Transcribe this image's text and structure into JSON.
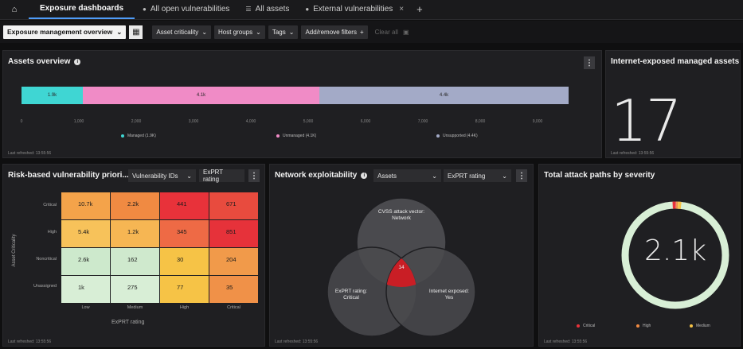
{
  "tabs": [
    {
      "label": "Exposure dashboards"
    },
    {
      "label": "All open vulnerabilities"
    },
    {
      "label": "All assets"
    },
    {
      "label": "External vulnerabilities"
    }
  ],
  "filters": {
    "view": "Exposure management overview",
    "chips": [
      "Asset criticality",
      "Host groups",
      "Tags",
      "Add/remove filters"
    ],
    "clear_label": "Clear all"
  },
  "assets_overview": {
    "title": "Assets overview",
    "refreshed": "Last refreshed: 13:55:56",
    "segments": [
      {
        "label": "1.9k",
        "value": 1.9,
        "color": "#3fd6d3"
      },
      {
        "label": "4.1k",
        "value": 4.1,
        "color": "#f08bc6"
      },
      {
        "label": "4.4k",
        "value": 4.4,
        "color": "#a3aac7"
      }
    ],
    "ticks": [
      "0",
      "1,000",
      "2,000",
      "3,000",
      "4,000",
      "5,000",
      "6,000",
      "7,000",
      "8,000",
      "9,000"
    ],
    "legend": [
      {
        "label": "Managed (1.9K)",
        "color": "#3fd6d3"
      },
      {
        "label": "Unmanaged (4.1K)",
        "color": "#f08bc6"
      },
      {
        "label": "Unsupported (4.4K)",
        "color": "#a3aac7"
      }
    ]
  },
  "internet_exposed": {
    "title": "Internet-exposed managed assets",
    "value": "17",
    "refreshed": "Last refreshed: 13:55:56"
  },
  "risk_matrix": {
    "title": "Risk-based vulnerability priori...",
    "dropdown1": "Vulnerability IDs",
    "dropdown2": "ExPRT rating",
    "y_axis": "Asset Criticality",
    "x_axis": "ExPRT rating",
    "rows": [
      "Critical",
      "High",
      "Noncritical",
      "Unassigned"
    ],
    "cols": [
      "Low",
      "Medium",
      "High",
      "Critical"
    ],
    "cells": [
      [
        "10.7k",
        "2.2k",
        "441",
        "671"
      ],
      [
        "5.4k",
        "1.2k",
        "345",
        "851"
      ],
      [
        "2.6k",
        "162",
        "30",
        "204"
      ],
      [
        "1k",
        "275",
        "77",
        "35"
      ]
    ],
    "colors": [
      [
        "#f4a34a",
        "#f08a42",
        "#e8323a",
        "#e84b3e"
      ],
      [
        "#f7c25a",
        "#f6b653",
        "#ee6a45",
        "#e6323a"
      ],
      [
        "#cde9cc",
        "#cfe9cd",
        "#f6c346",
        "#f19a4a"
      ],
      [
        "#d8eed6",
        "#d8eed6",
        "#f6c346",
        "#f09148"
      ]
    ],
    "refreshed": "Last refreshed: 13:55:56"
  },
  "network": {
    "title": "Network exploitability",
    "dropdown1": "Assets",
    "dropdown2": "ExPRT rating",
    "circle_top": "CVSS attack vector: Network",
    "circle_left": "ExPRT rating: Critical",
    "circle_right": "Internet exposed: Yes",
    "intersection": "14",
    "refreshed": "Last refreshed: 13:55:56"
  },
  "attack_paths": {
    "title": "Total attack paths by severity",
    "value": "2.1k",
    "legend": [
      {
        "label": "Critical",
        "color": "#e8323a"
      },
      {
        "label": "High",
        "color": "#f08a42"
      },
      {
        "label": "Medium",
        "color": "#f6c346"
      }
    ],
    "refreshed": "Last refreshed: 13:55:56"
  }
}
